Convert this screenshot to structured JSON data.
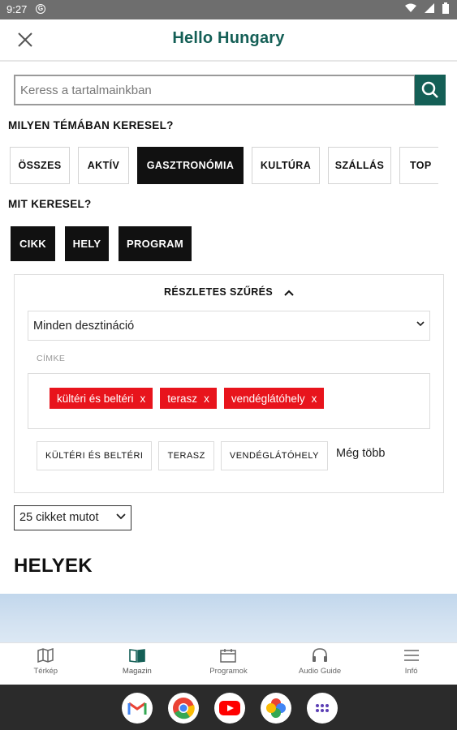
{
  "status": {
    "time": "9:27",
    "g_icon": "G"
  },
  "app": {
    "title": "Hello Hungary"
  },
  "search": {
    "placeholder": "Keress a tartalmainkban"
  },
  "topics": {
    "label": "MILYEN TÉMÁBAN KERESEL?",
    "items": [
      {
        "label": "ÖSSZES",
        "active": false
      },
      {
        "label": "AKTÍV",
        "active": false
      },
      {
        "label": "GASZTRONÓMIA",
        "active": true
      },
      {
        "label": "KULTÚRA",
        "active": false
      },
      {
        "label": "SZÁLLÁS",
        "active": false
      },
      {
        "label": "TOP",
        "active": false
      }
    ]
  },
  "types": {
    "label": "MIT KERESEL?",
    "items": [
      {
        "label": "CIKK"
      },
      {
        "label": "HELY"
      },
      {
        "label": "PROGRAM"
      }
    ]
  },
  "filter": {
    "heading": "RÉSZLETES SZŰRÉS",
    "destination": "Minden desztináció",
    "tag_label": "CÍMKE",
    "selected_tags": [
      "kültéri és beltéri",
      "terasz",
      "vendéglátóhely"
    ],
    "remove_symbol": "x",
    "suggestions": [
      "KÜLTÉRI ÉS BELTÉRI",
      "TERASZ",
      "VENDÉGLÁTÓHELY"
    ],
    "more": "Még több"
  },
  "count_select": {
    "value": "25 cikket mutot"
  },
  "section_title": "HELYEK",
  "bottom_nav": [
    {
      "label": "Térkép",
      "icon": "map-icon",
      "active": false
    },
    {
      "label": "Magazin",
      "icon": "magazine-icon",
      "active": true
    },
    {
      "label": "Programok",
      "icon": "calendar-icon",
      "active": false
    },
    {
      "label": "Audio Guide",
      "icon": "headphones-icon",
      "active": false
    },
    {
      "label": "Infó",
      "icon": "menu-icon",
      "active": false
    }
  ],
  "colors": {
    "brand": "#145f56",
    "tag": "#e8141c",
    "chip_active": "#111111"
  },
  "dock_apps": [
    "gmail-icon",
    "chrome-icon",
    "youtube-icon",
    "photos-icon",
    "apps-icon"
  ]
}
